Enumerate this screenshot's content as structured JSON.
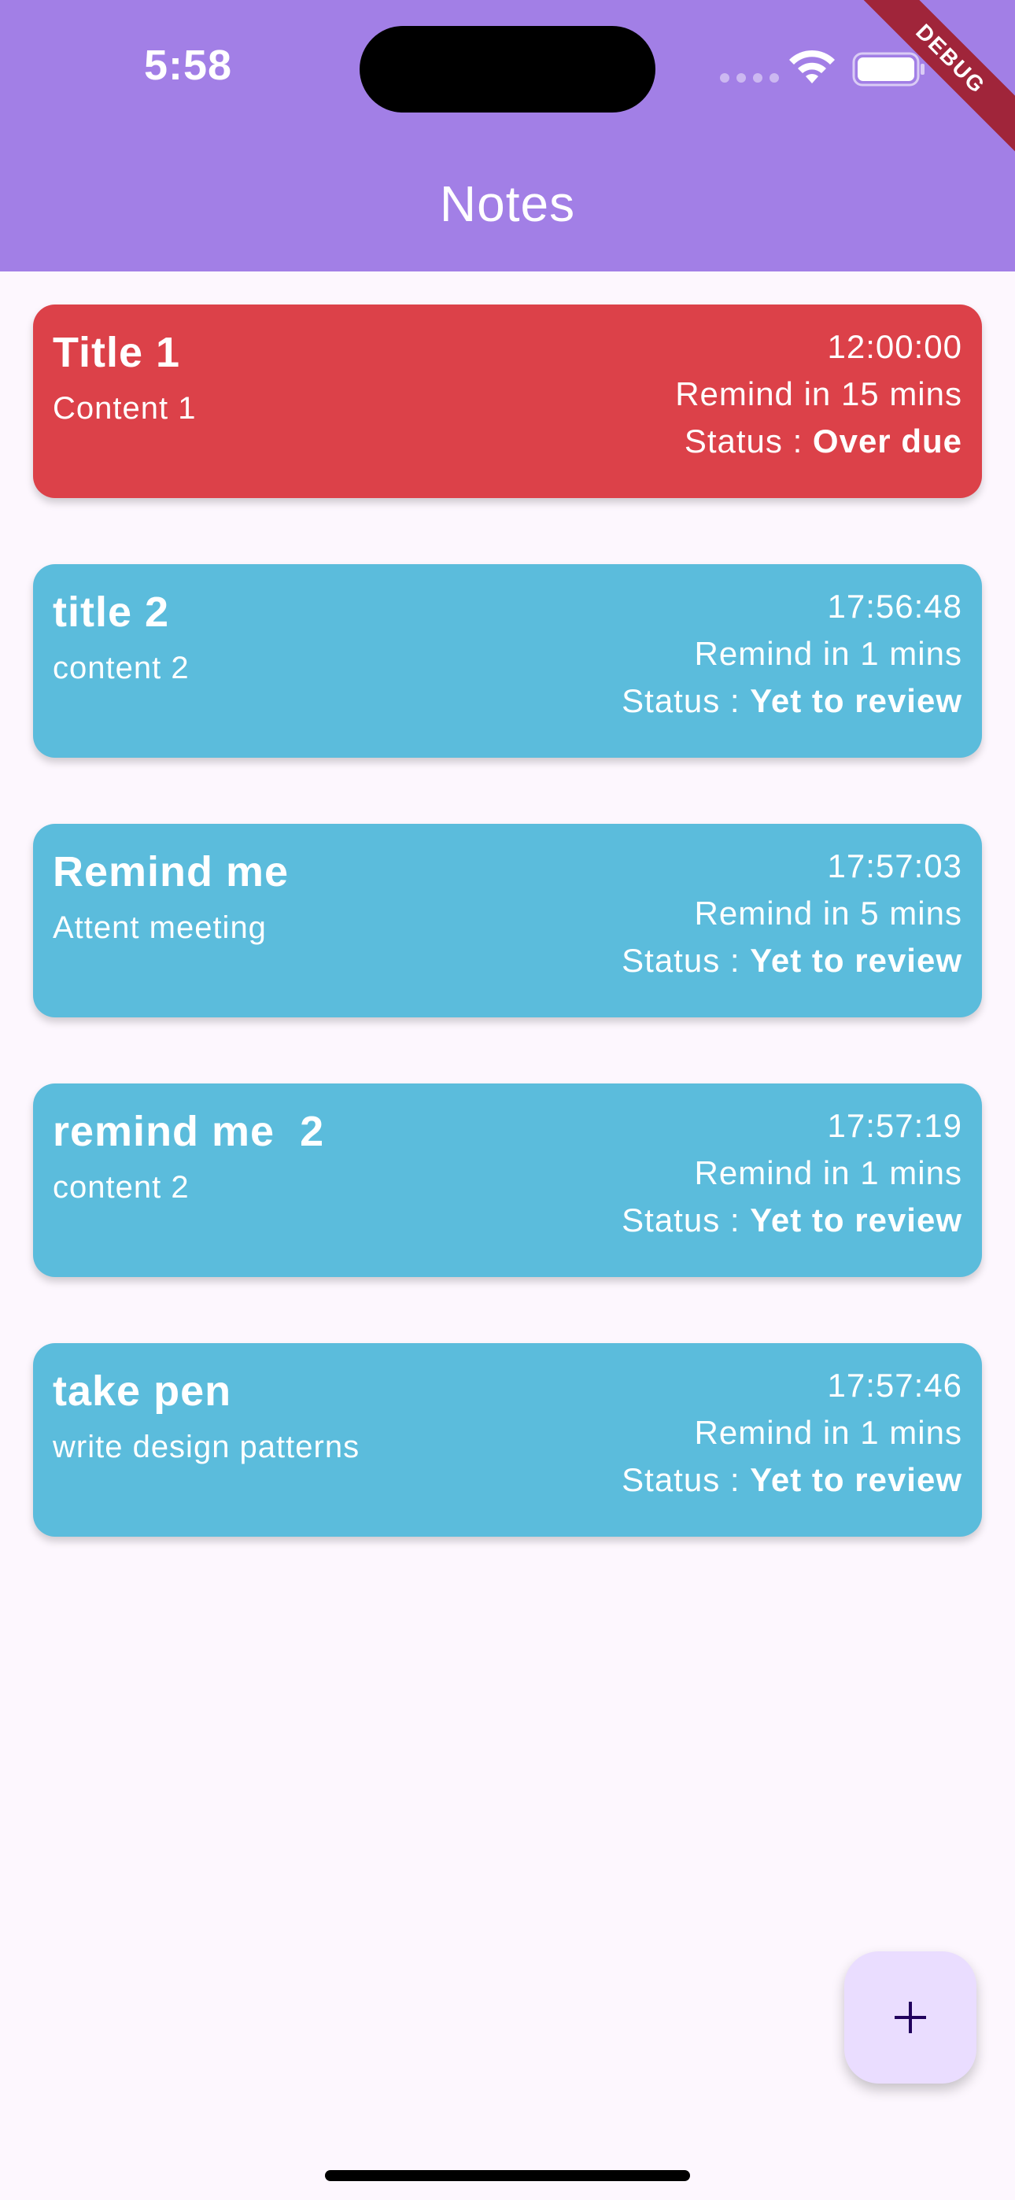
{
  "status_bar": {
    "time": "5:58"
  },
  "debug_banner": "DEBUG",
  "app_bar": {
    "title": "Notes"
  },
  "status_prefix": "Status : ",
  "notes": [
    {
      "title": "Title 1",
      "content": "Content 1",
      "time": "12:00:00",
      "remind": "Remind in 15 mins",
      "status": "Over due",
      "color": "#dc4149"
    },
    {
      "title": "title 2",
      "content": "content 2",
      "time": "17:56:48",
      "remind": "Remind in 1 mins",
      "status": "Yet to review",
      "color": "#5bbcdc"
    },
    {
      "title": "Remind me",
      "content": "Attent meeting",
      "time": "17:57:03",
      "remind": "Remind in 5 mins",
      "status": "Yet to review",
      "color": "#5bbcdc"
    },
    {
      "title": "remind me  2",
      "content": "content 2",
      "time": "17:57:19",
      "remind": "Remind in 1 mins",
      "status": "Yet to review",
      "color": "#5bbcdc"
    },
    {
      "title": "take pen",
      "content": "write design patterns",
      "time": "17:57:46",
      "remind": "Remind in 1 mins",
      "status": "Yet to review",
      "color": "#5bbcdc"
    }
  ],
  "fab": {
    "icon": "plus-icon"
  },
  "colors": {
    "app_bar": "#a27fe6",
    "background": "#fdf7fe",
    "fab": "#eaddff",
    "fab_icon": "#21005d",
    "overdue": "#dc4149",
    "pending": "#5bbcdc"
  }
}
